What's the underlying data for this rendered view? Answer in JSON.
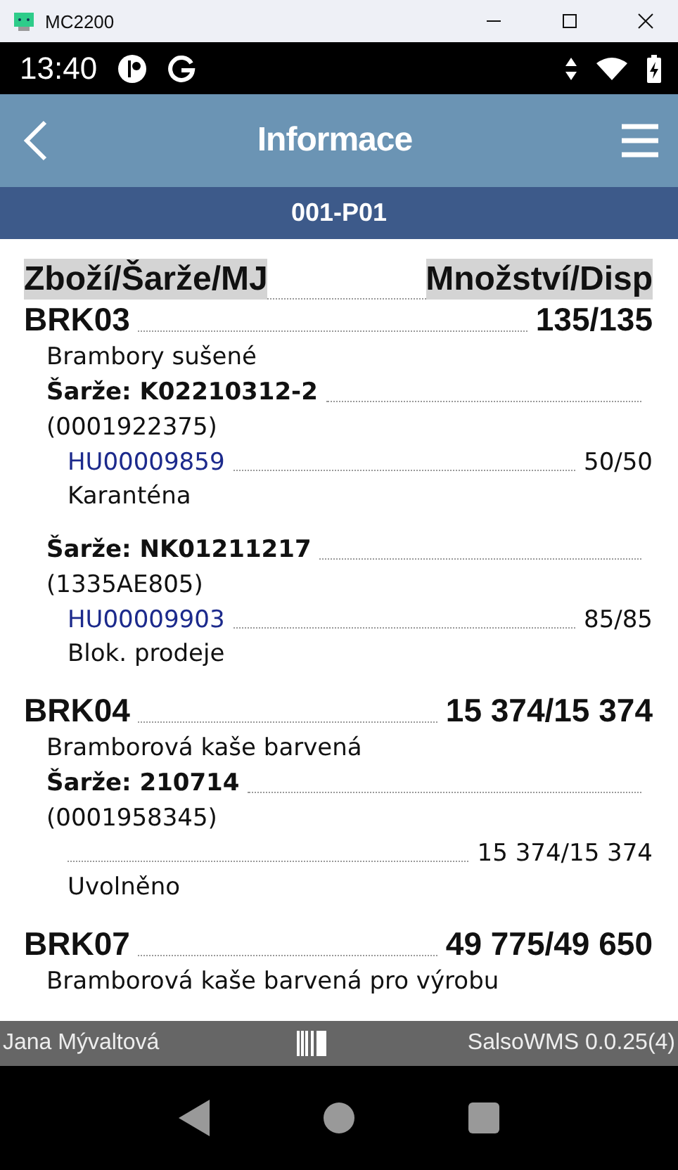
{
  "window": {
    "title": "MC2200"
  },
  "status_bar": {
    "time": "13:40"
  },
  "app_bar": {
    "title": "Informace"
  },
  "location": "001-P01",
  "table": {
    "columns": [
      "Zboží/Šarže/MJ",
      "Množství/Disp"
    ],
    "items": [
      {
        "code": "BRK03",
        "quantity": "135/135",
        "description": "Brambory sušené",
        "batches": [
          {
            "batch": "Šarže: K02210312-2",
            "lot": "(0001922375)",
            "units": [
              {
                "hu": "HU00009859",
                "quantity": "50/50",
                "status": "Karanténa"
              }
            ]
          },
          {
            "batch": "Šarže: NK01211217",
            "lot": "(1335AE805)",
            "units": [
              {
                "hu": "HU00009903",
                "quantity": "85/85",
                "status": "Blok. prodeje"
              }
            ]
          }
        ]
      },
      {
        "code": "BRK04",
        "quantity": "15 374/15 374",
        "description": "Bramborová kaše barvená",
        "batches": [
          {
            "batch": "Šarže: 210714",
            "lot": "(0001958345)",
            "units": [
              {
                "quantity": "15 374/15 374",
                "status": "Uvolněno"
              }
            ]
          }
        ]
      },
      {
        "code": "BRK07",
        "quantity": "49 775/49 650",
        "description": "Bramborová kaše barvená pro výrobu"
      }
    ]
  },
  "footer": {
    "user": "Jana Mývaltová",
    "version": "SalsoWMS 0.0.25(4)"
  }
}
